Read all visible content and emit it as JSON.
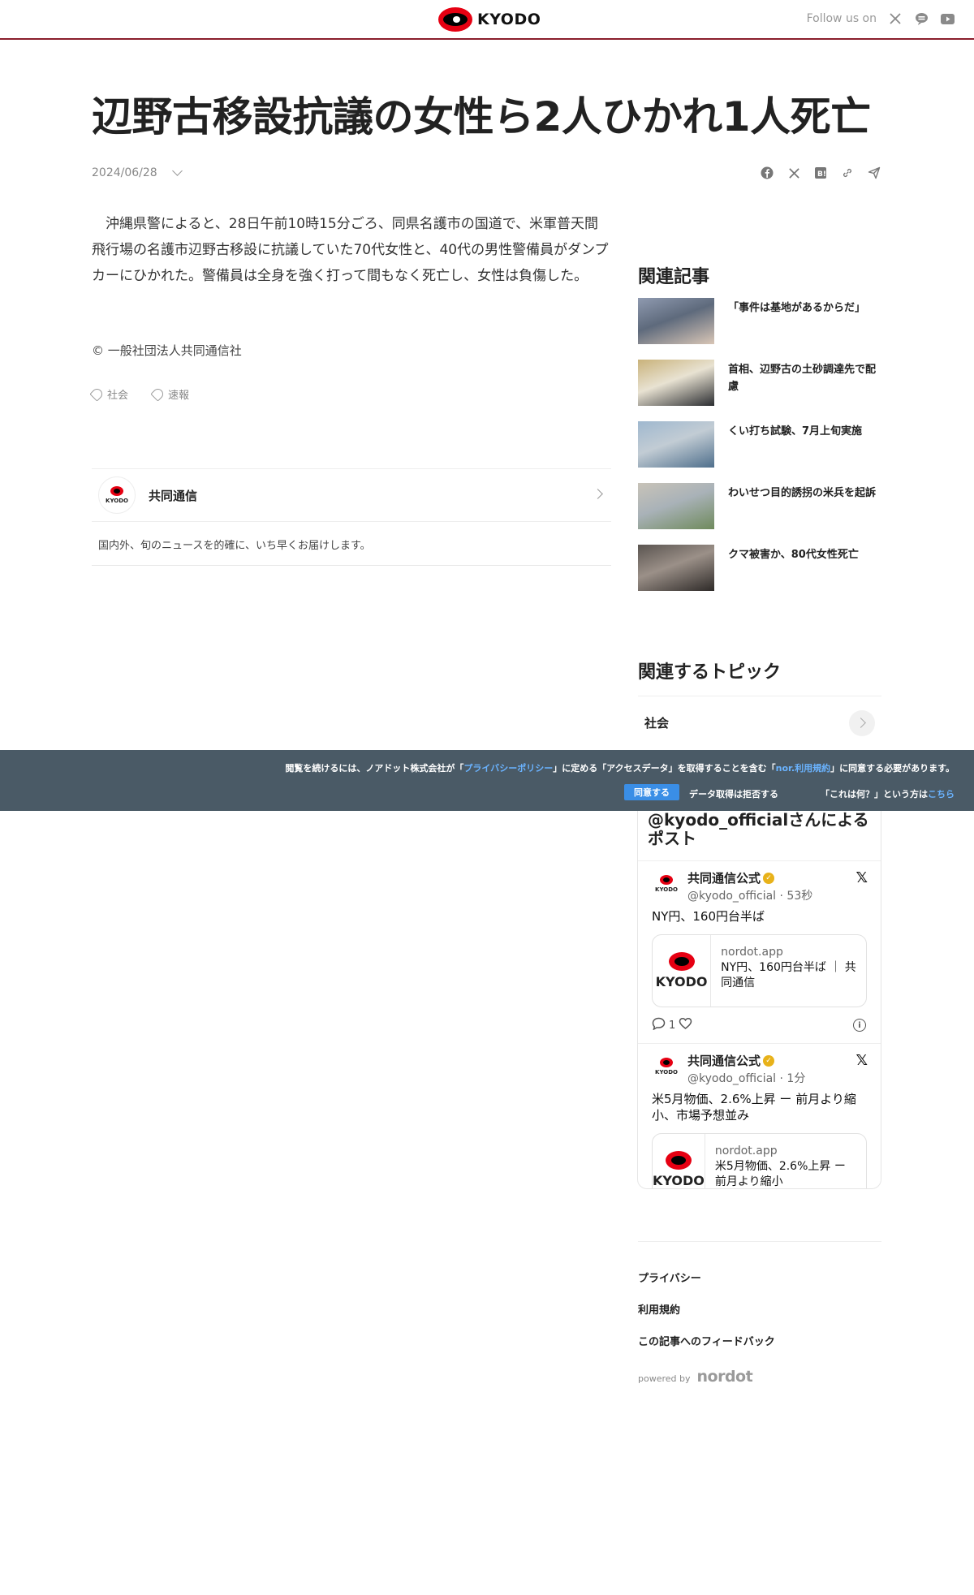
{
  "header": {
    "logo_text": "KYODO",
    "follow_label": "Follow us on",
    "social_icons": [
      "x-icon",
      "line-icon",
      "youtube-icon"
    ]
  },
  "article": {
    "title": "辺野古移設抗議の女性ら2人ひかれ1人死亡",
    "date": "2024/06/28",
    "body": "沖縄県警によると、28日午前10時15分ごろ、同県名護市の国道で、米軍普天間飛行場の名護市辺野古移設に抗議していた70代女性と、40代の男性警備員がダンプカーにひかれた。警備員は全身を強く打って間もなく死亡し、女性は負傷した。",
    "copyright": "© 一般社団法人共同通信社",
    "tags": [
      "社会",
      "速報"
    ],
    "share_icons": [
      "facebook-icon",
      "x-icon",
      "hatena-icon",
      "link-icon",
      "send-icon"
    ]
  },
  "publisher": {
    "avatar_text": "KYODO",
    "name": "共同通信",
    "description": "国内外、旬のニュースを的確に、いち早くお届けします。"
  },
  "sidebar": {
    "related_heading": "関連記事",
    "related": [
      {
        "title": "「事件は基地があるからだ」",
        "thumb_colors": [
          "#8f9ab0",
          "#d9c6b6",
          "#5e6a7c"
        ]
      },
      {
        "title": "首相、辺野古の土砂調達先で配慮",
        "thumb_colors": [
          "#c9b27a",
          "#2a2c30",
          "#e8e2d2"
        ]
      },
      {
        "title": "くい打ち試験、7月上旬実施",
        "thumb_colors": [
          "#9fb8cf",
          "#4f6f8c",
          "#c2ccd4"
        ]
      },
      {
        "title": "わいせつ目的誘拐の米兵を起訴",
        "thumb_colors": [
          "#c8c3b8",
          "#6f8a5c",
          "#a9b2b8"
        ]
      },
      {
        "title": "クマ被害か、80代女性死亡",
        "thumb_colors": [
          "#5a5450",
          "#2e2a28",
          "#9b9088"
        ]
      }
    ],
    "topics_heading": "関連するトピック",
    "topics": [
      "社会"
    ]
  },
  "consent": {
    "line1_pre": "閲覧を続けるには、ノアドット株式会社が「",
    "privacy_link": "プライバシーポリシー",
    "line1_mid": "」に定める「アクセスデータ」を取得することを含む「",
    "terms_link": "nor.利用規約",
    "line1_post": "」に同意する必要があります。",
    "agree": "同意する",
    "reject": "データ取得は拒否する",
    "what_pre": "「これは何？」という方は",
    "what_link": "こちら"
  },
  "timeline": {
    "heading": "@kyodo_officialさんによるポスト",
    "tweets": [
      {
        "name": "共同通信公式",
        "handle": "@kyodo_official · 53秒",
        "text": "NY円、160円台半ば",
        "card_domain": "nordot.app",
        "card_title": "NY円、160円台半ば ｜ 共同通信",
        "card_logo": "KYODO",
        "reply_count": "1"
      },
      {
        "name": "共同通信公式",
        "handle": "@kyodo_official · 1分",
        "text": "米5月物価、2.6%上昇 ー 前月より縮小、市場予想並み",
        "card_domain": "nordot.app",
        "card_title": "米5月物価、2.6%上昇 ー 前月より縮小",
        "card_logo": "KYODO"
      }
    ]
  },
  "footer": {
    "links": [
      "プライバシー",
      "利用規約",
      "この記事へのフィードバック"
    ],
    "powered_by": "powered by",
    "brand": "nordot"
  },
  "colors": {
    "header_border": "#8a1d2c",
    "kyodo_red": "#e60012",
    "consent_bg": "#4a5a66",
    "consent_link": "#6ab3ff",
    "agree_button": "#3a8ee6"
  }
}
